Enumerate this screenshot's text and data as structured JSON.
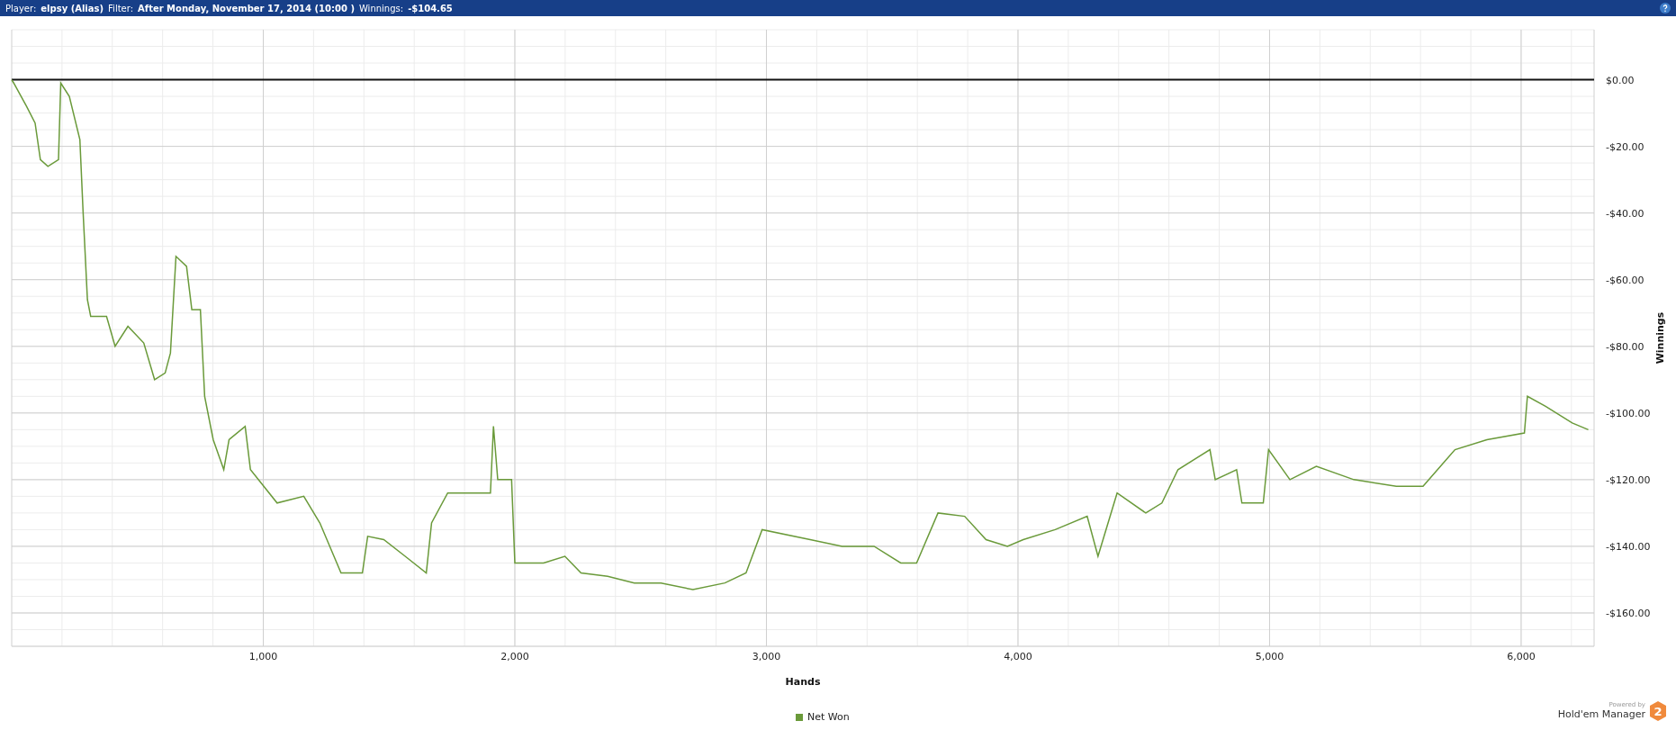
{
  "header": {
    "fields": [
      {
        "label": "Player:",
        "value": "elpsy (Alias)"
      },
      {
        "label": "Filter:",
        "value": "After Monday, November 17, 2014 (10:00 )"
      },
      {
        "label": "Winnings:",
        "value": "-$104.65"
      }
    ]
  },
  "chart": {
    "chart_data": {
      "type": "line",
      "grid": true,
      "xlabel": "Hands",
      "ylabel": "Winnings",
      "xlim": [
        0,
        6290
      ],
      "ylim": [
        -170,
        15
      ],
      "xticks": [
        {
          "value": 1000,
          "label": "1,000"
        },
        {
          "value": 2000,
          "label": "2,000"
        },
        {
          "value": 3000,
          "label": "3,000"
        },
        {
          "value": 4000,
          "label": "4,000"
        },
        {
          "value": 5000,
          "label": "5,000"
        },
        {
          "value": 6000,
          "label": "6,000"
        }
      ],
      "yticks": [
        {
          "value": 0,
          "label": "$0.00"
        },
        {
          "value": -20,
          "label": "-$20.00"
        },
        {
          "value": -40,
          "label": "-$40.00"
        },
        {
          "value": -60,
          "label": "-$60.00"
        },
        {
          "value": -80,
          "label": "-$80.00"
        },
        {
          "value": -100,
          "label": "-$100.00"
        },
        {
          "value": -120,
          "label": "-$120.00"
        },
        {
          "value": -140,
          "label": "-$140.00"
        },
        {
          "value": -160,
          "label": "-$160.00"
        }
      ],
      "x": [
        0,
        8,
        59,
        93,
        114,
        144,
        186,
        195,
        229,
        271,
        284,
        301,
        314,
        377,
        411,
        462,
        525,
        568,
        610,
        631,
        653,
        695,
        716,
        750,
        767,
        801,
        843,
        864,
        928,
        949,
        1055,
        1161,
        1225,
        1309,
        1394,
        1415,
        1479,
        1564,
        1648,
        1669,
        1733,
        1818,
        1903,
        1915,
        1932,
        1987,
        2000,
        2114,
        2199,
        2263,
        2369,
        2475,
        2581,
        2708,
        2835,
        2919,
        2983,
        3174,
        3301,
        3428,
        3534,
        3597,
        3682,
        3788,
        3873,
        3958,
        4021,
        4148,
        4275,
        4318,
        4394,
        4508,
        4572,
        4636,
        4763,
        4784,
        4869,
        4890,
        4975,
        4996,
        5081,
        5186,
        5335,
        5504,
        5610,
        5737,
        5864,
        6013,
        6025,
        6097,
        6203,
        6267
      ],
      "series": [
        {
          "name": "Net Won",
          "color": "#6a9a3a",
          "values": [
            0,
            -1,
            -8,
            -13,
            -24,
            -26,
            -24,
            -1,
            -5,
            -18,
            -40,
            -66,
            -71,
            -71,
            -80,
            -74,
            -79,
            -90,
            -88,
            -82,
            -53,
            -56,
            -69,
            -69,
            -95,
            -108,
            -117,
            -108,
            -104,
            -117,
            -127,
            -125,
            -133,
            -148,
            -148,
            -137,
            -138,
            -143,
            -148,
            -133,
            -124,
            -124,
            -124,
            -104,
            -120,
            -120,
            -145,
            -145,
            -143,
            -148,
            -149,
            -151,
            -151,
            -153,
            -151,
            -148,
            -135,
            -138,
            -140,
            -140,
            -145,
            -145,
            -130,
            -131,
            -138,
            -140,
            -138,
            -135,
            -131,
            -143,
            -124,
            -130,
            -127,
            -117,
            -111,
            -120,
            -117,
            -127,
            -127,
            -111,
            -120,
            -116,
            -120,
            -122,
            -122,
            -111,
            -108,
            -106,
            -95,
            -98,
            -103,
            -105
          ]
        }
      ]
    }
  },
  "branding": {
    "caption": "Powered by",
    "product": "Hold'em Manager",
    "mark": "2"
  }
}
